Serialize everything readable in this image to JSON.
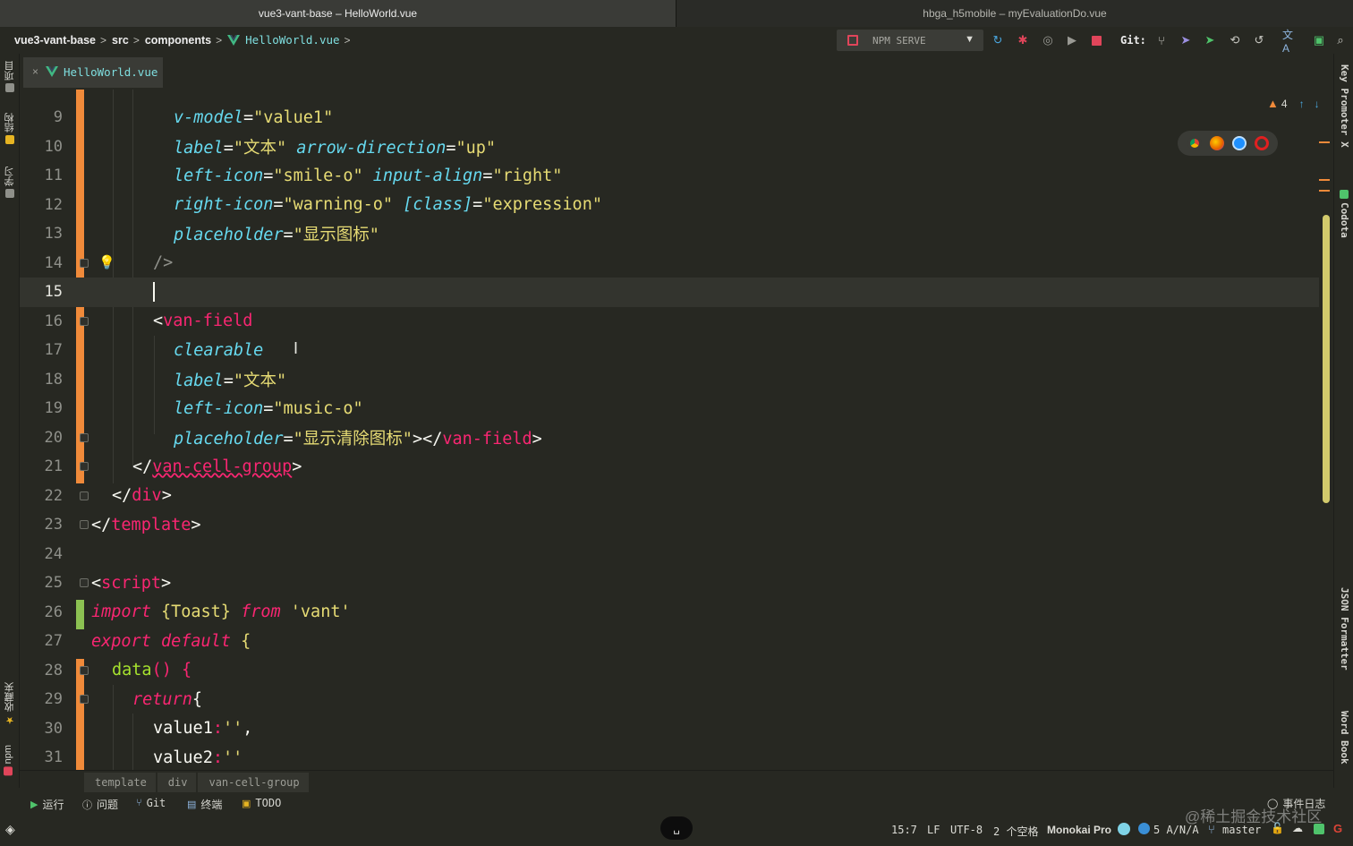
{
  "window": {
    "active_title": "vue3-vant-base – HelloWorld.vue",
    "inactive_title": "hbga_h5mobile – myEvaluationDo.vue"
  },
  "breadcrumb": {
    "project": "vue3-vant-base",
    "folder1": "src",
    "folder2": "components",
    "file": "HelloWorld.vue"
  },
  "toolbar": {
    "run_config": "NPM SERVE",
    "git_label": "Git:"
  },
  "left_tools": {
    "project": "项目",
    "structure": "结构",
    "learn": "学习",
    "favorites": "收藏夹",
    "npm": "npm"
  },
  "right_tools": {
    "key_promoter": "Key Promoter X",
    "codota": "Codota",
    "json_formatter": "JSON Formatter",
    "word_book": "Word Book"
  },
  "tab": {
    "label": "HelloWorld.vue"
  },
  "editor": {
    "warning_count": "4",
    "lines": [
      {
        "n": "9"
      },
      {
        "n": "10"
      },
      {
        "n": "11"
      },
      {
        "n": "12"
      },
      {
        "n": "13"
      },
      {
        "n": "14"
      },
      {
        "n": "15"
      },
      {
        "n": "16"
      },
      {
        "n": "17"
      },
      {
        "n": "18"
      },
      {
        "n": "19"
      },
      {
        "n": "20"
      },
      {
        "n": "21"
      },
      {
        "n": "22"
      },
      {
        "n": "23"
      },
      {
        "n": "24"
      },
      {
        "n": "25"
      },
      {
        "n": "26"
      },
      {
        "n": "27"
      },
      {
        "n": "28"
      },
      {
        "n": "29"
      },
      {
        "n": "30"
      },
      {
        "n": "31"
      }
    ],
    "code": {
      "l9_attr": "v-model",
      "l9_val": "\"value1\"",
      "l10_attr1": "label",
      "l10_val1": "\"文本\"",
      "l10_attr2": "arrow-direction",
      "l10_val2": "\"up\"",
      "l11_attr1": "left-icon",
      "l11_val1": "\"smile-o\"",
      "l11_attr2": "input-align",
      "l11_val2": "\"right\"",
      "l12_attr1": "right-icon",
      "l12_val1": "\"warning-o\"",
      "l12_attr2": "[class]",
      "l12_val2": "\"expression\"",
      "l13_attr": "placeholder",
      "l13_val": "\"显示图标\"",
      "l14": "/>",
      "l16_tag": "van-field",
      "l17_attr": "clearable",
      "l18_attr": "label",
      "l18_val": "\"文本\"",
      "l19_attr": "left-icon",
      "l19_val": "\"music-o\"",
      "l20_attr": "placeholder",
      "l20_val": "\"显示清除图标\"",
      "l20_close": "van-field",
      "l21_tag": "van-cell-group",
      "l22_tag": "div",
      "l23_tag": "template",
      "l25_tag": "script",
      "l26_kw1": "import",
      "l26_obj": "{Toast}",
      "l26_kw2": "from",
      "l26_str": "'vant'",
      "l27_kw": "export default",
      "l27_brace": "{",
      "l28_fn": "data",
      "l28_rest": "() {",
      "l29_kw": "return",
      "l29_brace": "{",
      "l30_key": "value1",
      "l30_val": "''",
      "l31_key": "value2",
      "l31_val": "''"
    }
  },
  "crumbbar": {
    "items": [
      "template",
      "div",
      "van-cell-group"
    ]
  },
  "tool_windows": {
    "run": "运行",
    "problems": "问题",
    "git": "Git",
    "terminal": "终端",
    "todo": "TODO",
    "event_log": "事件日志"
  },
  "status": {
    "position": "15:7",
    "line_sep": "LF",
    "encoding": "UTF-8",
    "indent": "2 个空格",
    "theme": "Monokai Pro",
    "analysis": "5 A/N/A",
    "branch": "master",
    "space_key": "␣",
    "watermark": "@稀土掘金技术社区"
  },
  "colors": {
    "background": "#272822",
    "tag": "#f92672",
    "attribute": "#66d9ef",
    "string": "#e6db74",
    "function": "#a6e22e",
    "modified_bar": "#f08a3a",
    "added_bar": "#8cc152"
  }
}
